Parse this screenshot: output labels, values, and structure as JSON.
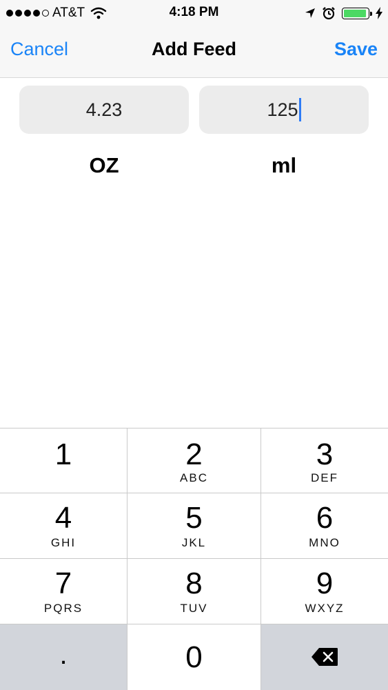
{
  "status_bar": {
    "carrier": "AT&T",
    "time": "4:18 PM",
    "signal_bars_filled": 4,
    "signal_bars_total": 5,
    "battery_level": 0.95,
    "battery_color": "#4cd964"
  },
  "nav": {
    "cancel_label": "Cancel",
    "title": "Add Feed",
    "save_label": "Save",
    "accent_color": "#1a84f7"
  },
  "fields": {
    "oz_value": "4.23",
    "ml_value": "125"
  },
  "units": {
    "oz_label": "OZ",
    "ml_label": "ml"
  },
  "keypad": {
    "keys": [
      {
        "digit": "1",
        "letters": ""
      },
      {
        "digit": "2",
        "letters": "ABC"
      },
      {
        "digit": "3",
        "letters": "DEF"
      },
      {
        "digit": "4",
        "letters": "GHI"
      },
      {
        "digit": "5",
        "letters": "JKL"
      },
      {
        "digit": "6",
        "letters": "MNO"
      },
      {
        "digit": "7",
        "letters": "PQRS"
      },
      {
        "digit": "8",
        "letters": "TUV"
      },
      {
        "digit": "9",
        "letters": "WXYZ"
      }
    ],
    "decimal_label": ".",
    "zero_label": "0",
    "delete_icon": "backspace-icon"
  }
}
